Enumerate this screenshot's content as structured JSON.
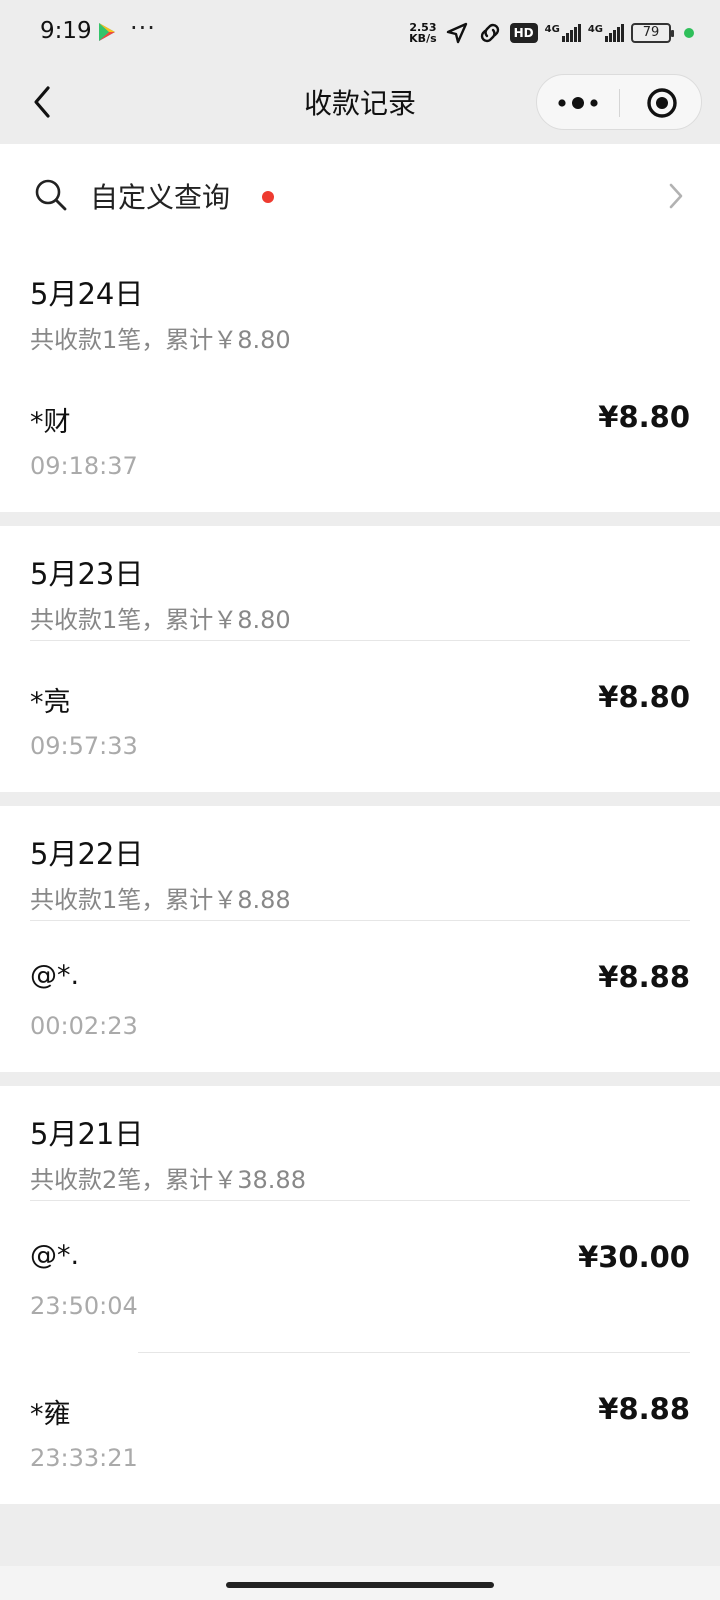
{
  "status": {
    "time": "9:19",
    "dots": "···",
    "speed_top": "2.53",
    "speed_bottom": "KB/s",
    "hd": "HD",
    "net1": "4G",
    "net2": "4G",
    "battery": "79"
  },
  "nav": {
    "title": "收款记录"
  },
  "search": {
    "label": "自定义查询"
  },
  "days": [
    {
      "date": "5月24日",
      "summary": "共收款1笔，累计￥8.80",
      "records": [
        {
          "name": "*财",
          "amount": "¥8.80",
          "time": "09:18:37"
        }
      ]
    },
    {
      "date": "5月23日",
      "summary": "共收款1笔，累计￥8.80",
      "records": [
        {
          "name": "*亮",
          "amount": "¥8.80",
          "time": "09:57:33"
        }
      ]
    },
    {
      "date": "5月22日",
      "summary": "共收款1笔，累计￥8.88",
      "records": [
        {
          "name": "@*.",
          "amount": "¥8.88",
          "time": "00:02:23"
        }
      ]
    },
    {
      "date": "5月21日",
      "summary": "共收款2笔，累计￥38.88",
      "records": [
        {
          "name": "@*.",
          "amount": "¥30.00",
          "time": "23:50:04"
        },
        {
          "name": "*雍",
          "amount": "¥8.88",
          "time": "23:33:21"
        }
      ]
    }
  ],
  "colors": {
    "background": "#ededed",
    "card": "#ffffff",
    "badge_red": "#ee3b30",
    "secondary_text": "#888888"
  }
}
